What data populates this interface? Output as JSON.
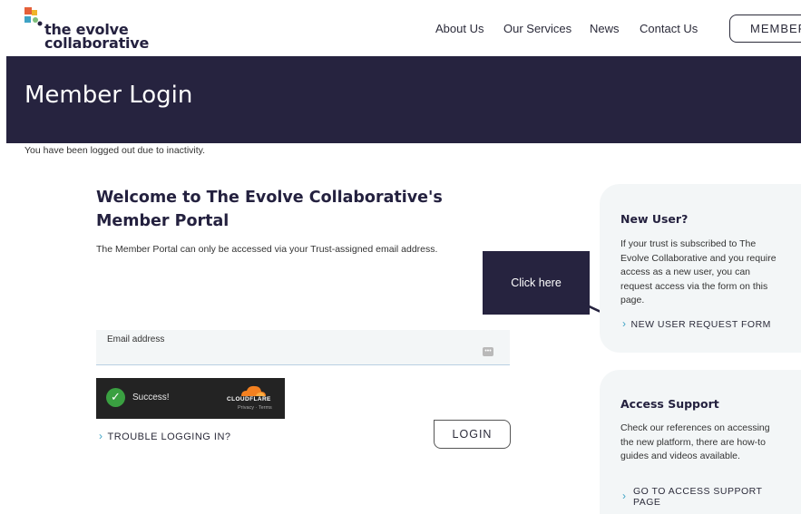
{
  "header": {
    "logo_line1": "the evolve",
    "logo_line2": "collaborative",
    "nav": [
      "About Us",
      "Our Services",
      "News",
      "Contact Us"
    ],
    "member_button": "MEMBER"
  },
  "banner": {
    "title": "Member Login"
  },
  "status_message": "You have been logged out due to inactivity.",
  "main": {
    "heading": "Welcome to The Evolve Collaborative's Member Portal",
    "intro": "The Member Portal can only be accessed via your Trust-assigned email address.",
    "email": {
      "label": "Email address",
      "value": "",
      "placeholder": ""
    },
    "captcha": {
      "status": "Success!",
      "brand": "CLOUDFLARE",
      "links": "Privacy · Terms"
    },
    "trouble_link": "TROUBLE LOGGING IN?",
    "login_button": "LOGIN"
  },
  "annotation": {
    "tooltip": "Click here"
  },
  "sidebar": {
    "new_user": {
      "title": "New User?",
      "text": "If your trust is subscribed to The Evolve Collaborative and you require access as a new user, you can request access via the form on this page.",
      "link": "NEW USER REQUEST FORM"
    },
    "access_support": {
      "title": "Access Support",
      "text": "Check our references on accessing the new platform, there are how-to guides and videos available.",
      "link_line1": "GO TO ACCESS SUPPORT",
      "link_line2": "PAGE"
    }
  },
  "icons": [
    "logo-mark-icon",
    "password-manager-icon",
    "check-icon",
    "cloudflare-icon",
    "chevron-right-icon",
    "arrow-icon"
  ],
  "colors": {
    "brand_navy": "#26233f",
    "accent_teal": "#3ea3c5",
    "card_bg": "#f3f6f7",
    "success_green": "#3aa041",
    "cloudflare_orange": "#f38020"
  }
}
